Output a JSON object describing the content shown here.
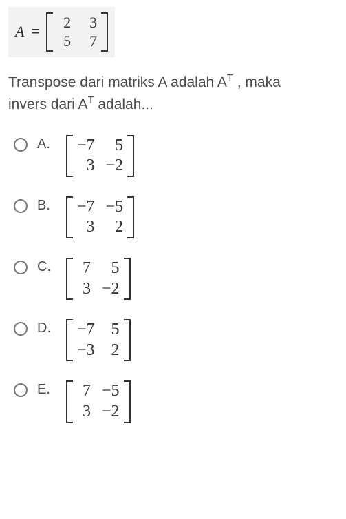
{
  "given": {
    "var": "A",
    "equals": "=",
    "m": [
      "2",
      "3",
      "5",
      "7"
    ]
  },
  "question": {
    "line1": "Transpose dari matriks A adalah A",
    "sup1": "T",
    "mid1": " , maka",
    "line2": "invers dari A",
    "sup2": "T",
    "end2": " adalah..."
  },
  "options": [
    {
      "label": "A.",
      "m": [
        "−7",
        "5",
        "3",
        "−2"
      ]
    },
    {
      "label": "B.",
      "m": [
        "−7",
        "−5",
        "3",
        "2"
      ]
    },
    {
      "label": "C.",
      "m": [
        "7",
        "5",
        "3",
        "−2"
      ]
    },
    {
      "label": "D.",
      "m": [
        "−7",
        "5",
        "−3",
        "2"
      ]
    },
    {
      "label": "E.",
      "m": [
        "7",
        "−5",
        "3",
        "−2"
      ]
    }
  ]
}
